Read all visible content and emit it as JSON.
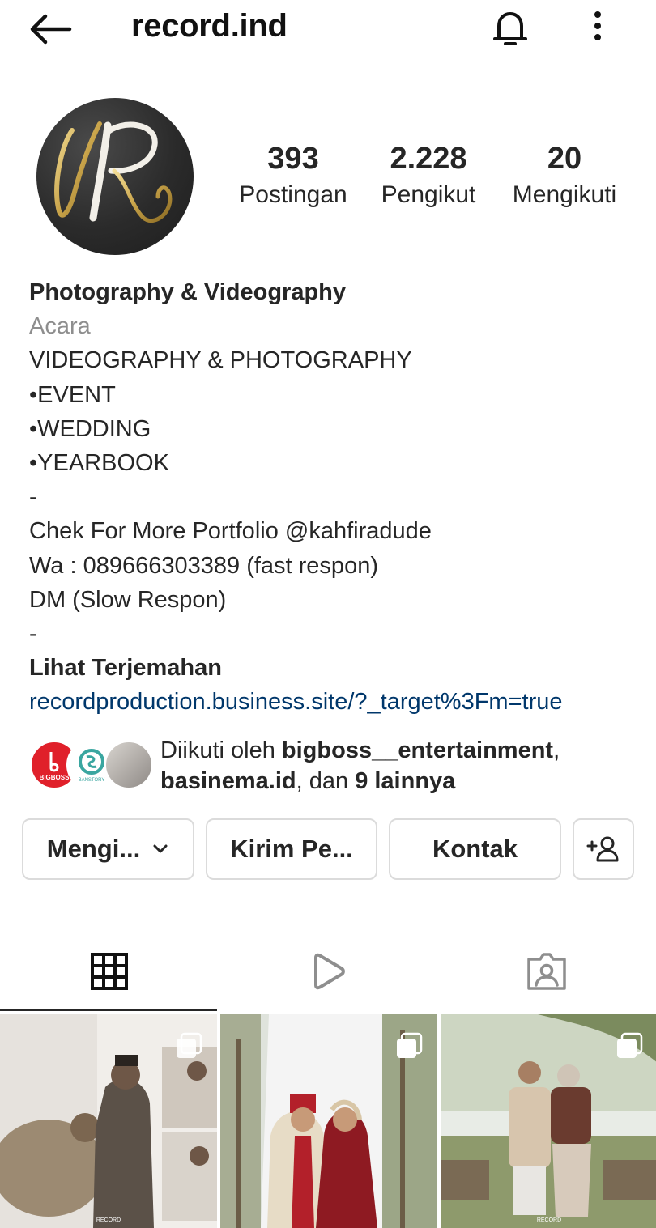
{
  "header": {
    "username": "record.ind",
    "back_icon": "arrow-left-icon",
    "notification_icon": "bell-icon",
    "more_icon": "more-vertical-icon"
  },
  "profile": {
    "avatar_letter": "R",
    "stats": {
      "posts_count": "393",
      "posts_label": "Postingan",
      "followers_count": "2.228",
      "followers_label": "Pengikut",
      "following_count": "20",
      "following_label": "Mengikuti"
    }
  },
  "bio": {
    "name": "Photography & Videography",
    "category": "Acara",
    "lines": [
      "VIDEOGRAPHY & PHOTOGRAPHY",
      "•EVENT",
      "•WEDDING",
      "•YEARBOOK",
      "-",
      "Chek For More Portfolio @kahfiradude",
      "Wa : 089666303389 (fast respon)",
      "DM (Slow Respon)",
      "-"
    ],
    "translate_label": "Lihat Terjemahan",
    "link": "recordproduction.business.site/?_target%3Fm=true"
  },
  "followed_by": {
    "prefix": "Diikuti oleh ",
    "account1": "bigboss__entertainment",
    "sep1": ",",
    "account2": "basinema.id",
    "middle": ", dan ",
    "others": "9 lainnya",
    "avatar1_text": "BIGBOSS",
    "avatar2_text": "BANSTORY"
  },
  "actions": {
    "following_label": "Mengi...",
    "message_label": "Kirim Pe...",
    "contact_label": "Kontak"
  },
  "tabs": {
    "grid_icon": "grid-icon",
    "reels_icon": "play-icon",
    "tagged_icon": "tagged-person-icon"
  },
  "posts": [
    {
      "multi": true,
      "watermark": "RECORD"
    },
    {
      "multi": true,
      "watermark": ""
    },
    {
      "multi": true,
      "watermark": "RECORD"
    }
  ],
  "colors": {
    "text": "#262626",
    "muted": "#8e8e8e",
    "link": "#00376b",
    "border": "#dbdbdb",
    "gold": "#c9a44a"
  }
}
